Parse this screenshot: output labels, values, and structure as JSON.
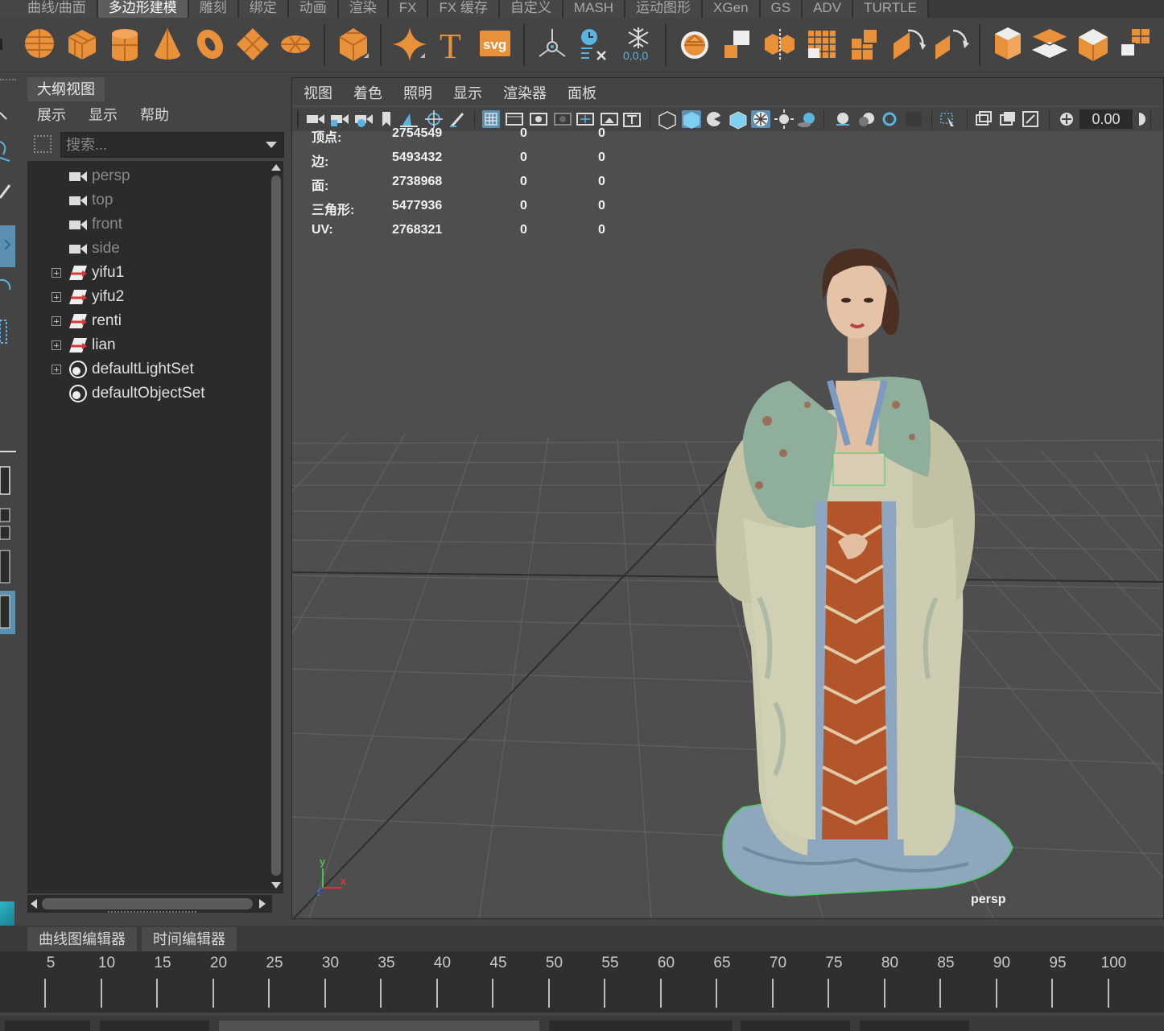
{
  "shelf_tabs": [
    {
      "label": "曲线/曲面",
      "active": false
    },
    {
      "label": "多边形建模",
      "active": true
    },
    {
      "label": "雕刻",
      "active": false
    },
    {
      "label": "绑定",
      "active": false
    },
    {
      "label": "动画",
      "active": false
    },
    {
      "label": "渲染",
      "active": false
    },
    {
      "label": "FX",
      "active": false
    },
    {
      "label": "FX 缓存",
      "active": false
    },
    {
      "label": "自定义",
      "active": false
    },
    {
      "label": "MASH",
      "active": false
    },
    {
      "label": "运动图形",
      "active": false
    },
    {
      "label": "XGen",
      "active": false
    },
    {
      "label": "GS",
      "active": false
    },
    {
      "label": "ADV",
      "active": false
    },
    {
      "label": "TURTLE",
      "active": false
    }
  ],
  "shelf": {
    "text_tool": "T",
    "svg_tool": "svg",
    "origin_coords": "0,0,0",
    "icons": [
      "sphere-icon",
      "cube-icon",
      "cylinder-icon",
      "cone-icon",
      "torus-icon",
      "plane-icon",
      "disc-icon",
      "platonic-icon",
      "super-shape-icon",
      "type-icon",
      "svg-icon",
      "center-pivot-icon",
      "delete-history-icon",
      "freeze-transform-icon",
      "combine-icon",
      "separate-icon",
      "boolean-icon",
      "smooth-icon",
      "extract-icon",
      "mirror-icon",
      "bridge-icon",
      "extrude-icon",
      "bevel-icon",
      "multi-cut-icon",
      "unfold-icon",
      "layout-uv-icon"
    ],
    "accent_color": "#e8913a"
  },
  "outliner": {
    "tab_title": "大纲视图",
    "menu": [
      "展示",
      "显示",
      "帮助"
    ],
    "search_placeholder": "搜索...",
    "items": [
      {
        "label": "persp",
        "type": "camera",
        "expandable": false
      },
      {
        "label": "top",
        "type": "camera",
        "expandable": false
      },
      {
        "label": "front",
        "type": "camera",
        "expandable": false
      },
      {
        "label": "side",
        "type": "camera",
        "expandable": false
      },
      {
        "label": "yifu1",
        "type": "mesh",
        "expandable": true
      },
      {
        "label": "yifu2",
        "type": "mesh",
        "expandable": true
      },
      {
        "label": "renti",
        "type": "mesh",
        "expandable": true
      },
      {
        "label": "lian",
        "type": "mesh",
        "expandable": true
      },
      {
        "label": "defaultLightSet",
        "type": "set",
        "expandable": true
      },
      {
        "label": "defaultObjectSet",
        "type": "set",
        "expandable": false
      }
    ]
  },
  "viewport": {
    "menu": [
      "视图",
      "着色",
      "照明",
      "显示",
      "渲染器",
      "面板"
    ],
    "exposure_value": "0.00",
    "camera_label": "persp",
    "axis_labels": {
      "y": "y",
      "x": "x",
      "z": "z"
    },
    "hud_rows": [
      {
        "label": "顶点:",
        "value": "2754549",
        "c1": "0",
        "c2": "0"
      },
      {
        "label": "边:",
        "value": "5493432",
        "c1": "0",
        "c2": "0"
      },
      {
        "label": "面:",
        "value": "2738968",
        "c1": "0",
        "c2": "0"
      },
      {
        "label": "三角形:",
        "value": "5477936",
        "c1": "0",
        "c2": "0"
      },
      {
        "label": "UV:",
        "value": "2768321",
        "c1": "0",
        "c2": "0"
      }
    ]
  },
  "editor_tabs": [
    "曲线图编辑器",
    "时间编辑器"
  ],
  "timeline": {
    "labels": [
      "5",
      "10",
      "15",
      "20",
      "25",
      "30",
      "35",
      "40",
      "45",
      "50",
      "55",
      "60",
      "65",
      "70",
      "75",
      "80",
      "85",
      "90",
      "95",
      "100"
    ]
  }
}
